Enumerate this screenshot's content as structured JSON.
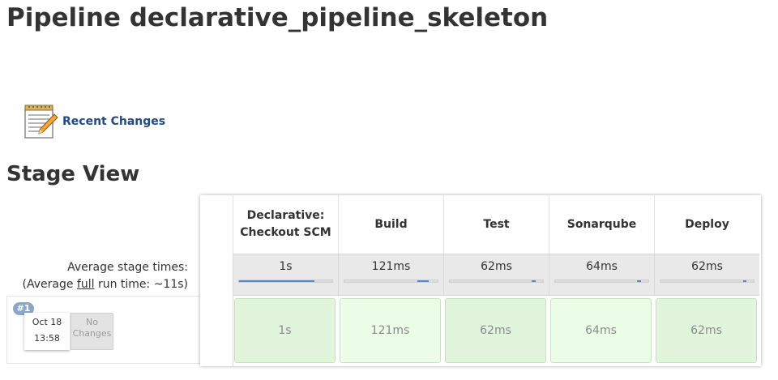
{
  "page": {
    "title": "Pipeline declarative_pipeline_skeleton"
  },
  "recent_changes": {
    "label": "Recent Changes",
    "icon": "notepad-pencil-icon"
  },
  "stage_view": {
    "title": "Stage View",
    "avg_label": "Average stage times:",
    "avg_full_prefix": "(Average ",
    "avg_full_word": "full",
    "avg_full_suffix": " run time: ~11s)",
    "stages": [
      {
        "name": "Declarative: Checkout SCM",
        "avg": "1s",
        "progress": 0.81
      },
      {
        "name": "Build",
        "avg": "121ms",
        "progress": 0.12
      },
      {
        "name": "Test",
        "avg": "62ms",
        "progress": 0.04
      },
      {
        "name": "Sonarqube",
        "avg": "64ms",
        "progress": 0.04
      },
      {
        "name": "Deploy",
        "avg": "62ms",
        "progress": 0.03
      }
    ],
    "runs": [
      {
        "badge": "#1",
        "date": "Oct 18",
        "time": "13:58",
        "changes": "No Changes",
        "durations": [
          "1s",
          "121ms",
          "62ms",
          "64ms",
          "62ms"
        ]
      }
    ]
  },
  "colors": {
    "success_cell": "#e0f5dc",
    "progress_bar": "#5b85c9",
    "badge": "#8aa6c9",
    "link": "#204a87"
  }
}
